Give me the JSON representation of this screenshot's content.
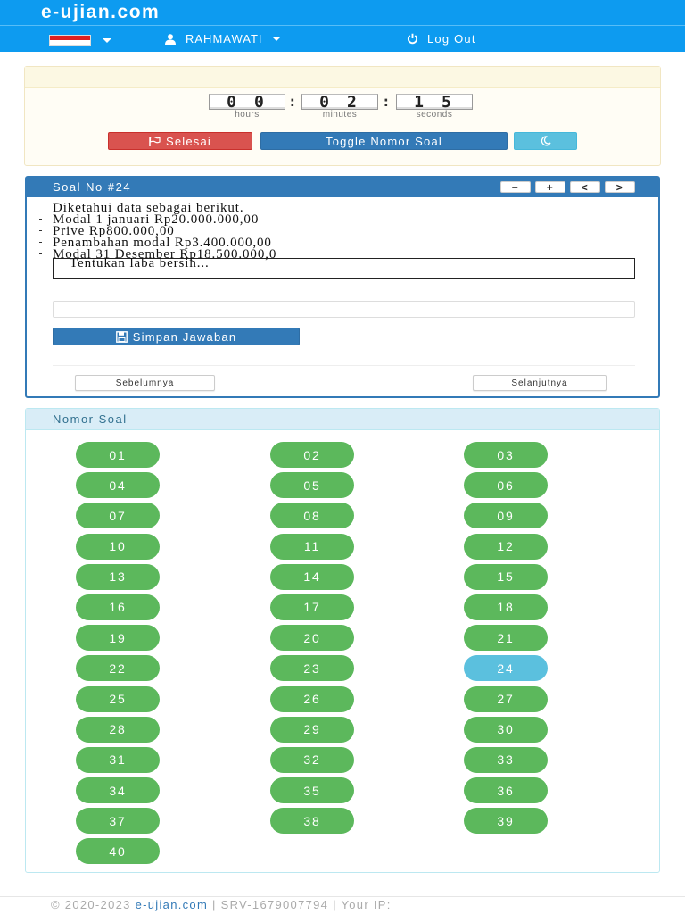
{
  "brand": "e-ujian.com",
  "nav": {
    "language_flag": "indonesia-flag",
    "user_name": "RAHMAWATI",
    "logout_label": "Log Out"
  },
  "timer": {
    "hours": "00",
    "minutes": "02",
    "seconds": "15",
    "hours_label": "hours",
    "minutes_label": "minutes",
    "seconds_label": "seconds"
  },
  "actions": {
    "finish_label": "Selesai",
    "toggle_label": "Toggle Nomor Soal",
    "night_mode_icon": "moon-icon"
  },
  "question": {
    "title": "Soal No #24",
    "tools": [
      "−",
      "+",
      "<",
      ">"
    ],
    "lines": [
      "Diketahui data sebagai berikut.",
      "Modal 1 januari Rp20.000.000,00",
      "Prive Rp800.000,00",
      "Penambahan modal Rp3.400.000,00",
      "Modal 31 Desember Rp18.500.000,0"
    ],
    "prompt": "Tentukan laba bersih...",
    "answer_value": "",
    "save_label": "Simpan Jawaban",
    "prev_label": "Sebelumnya",
    "next_label": "Selanjutnya"
  },
  "numbers": {
    "title": "Nomor Soal",
    "active": "24",
    "items": [
      "01",
      "02",
      "03",
      "04",
      "05",
      "06",
      "07",
      "08",
      "09",
      "10",
      "11",
      "12",
      "13",
      "14",
      "15",
      "16",
      "17",
      "18",
      "19",
      "20",
      "21",
      "22",
      "23",
      "24",
      "25",
      "26",
      "27",
      "28",
      "29",
      "30",
      "31",
      "32",
      "33",
      "34",
      "35",
      "36",
      "37",
      "38",
      "39",
      "40"
    ]
  },
  "footer": {
    "copyright": "© 2020-2023",
    "site_link": "e-ujian.com",
    "server": "| SRV-1679007794 | Your IP:"
  },
  "colors": {
    "primary": "#337ab7",
    "navbar": "#0d9bf0",
    "success": "#5cb85c",
    "info": "#5bc0de",
    "danger": "#d9534f"
  }
}
